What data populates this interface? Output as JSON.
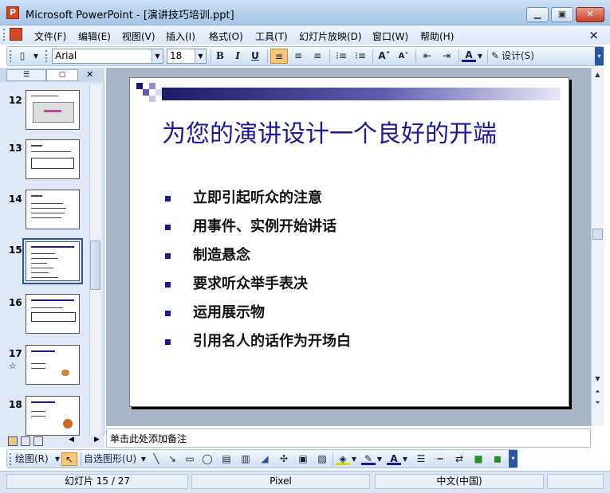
{
  "window": {
    "app_icon_glyph": "P",
    "title": "Microsoft PowerPoint - [演讲技巧培训.ppt]",
    "minimize_glyph": "▁",
    "restore_glyph": "▣",
    "close_glyph": "✕"
  },
  "menu": {
    "items": [
      "文件(F)",
      "编辑(E)",
      "视图(V)",
      "插入(I)",
      "格式(O)",
      "工具(T)",
      "幻灯片放映(D)",
      "窗口(W)",
      "帮助(H)"
    ],
    "doc_close": "×"
  },
  "toolbar": {
    "font": "Arial",
    "font_size": "18",
    "bold": "B",
    "italic": "I",
    "underline": "U",
    "design_label": "设计(S)"
  },
  "slide_panel": {
    "tab_outline_glyph": "☰",
    "tab_slides_glyph": "▢",
    "close_glyph": "✕",
    "slides": [
      {
        "number": "12"
      },
      {
        "number": "13"
      },
      {
        "number": "14"
      },
      {
        "number": "15",
        "selected": true
      },
      {
        "number": "16"
      },
      {
        "number": "17",
        "star": "☆"
      },
      {
        "number": "18"
      }
    ]
  },
  "slide": {
    "title": "为您的演讲设计一个良好的开端",
    "bullets": [
      "立即引起听众的注意",
      "用事件、实例开始讲话",
      "制造悬念",
      "要求听众举手表决",
      "运用展示物",
      "引用名人的话作为开场白"
    ]
  },
  "notes": {
    "placeholder": "单击此处添加备注"
  },
  "drawbar": {
    "draw_label": "绘图(R)",
    "autoshapes_label": "自选图形(U)"
  },
  "status": {
    "slide_position": "幻灯片 15 / 27",
    "design": "Pixel",
    "language": "中文(中国)"
  },
  "colors": {
    "title_blue": "#1a1a8c",
    "titlebar": "#b3cfec",
    "selection": "#2a56a0"
  }
}
